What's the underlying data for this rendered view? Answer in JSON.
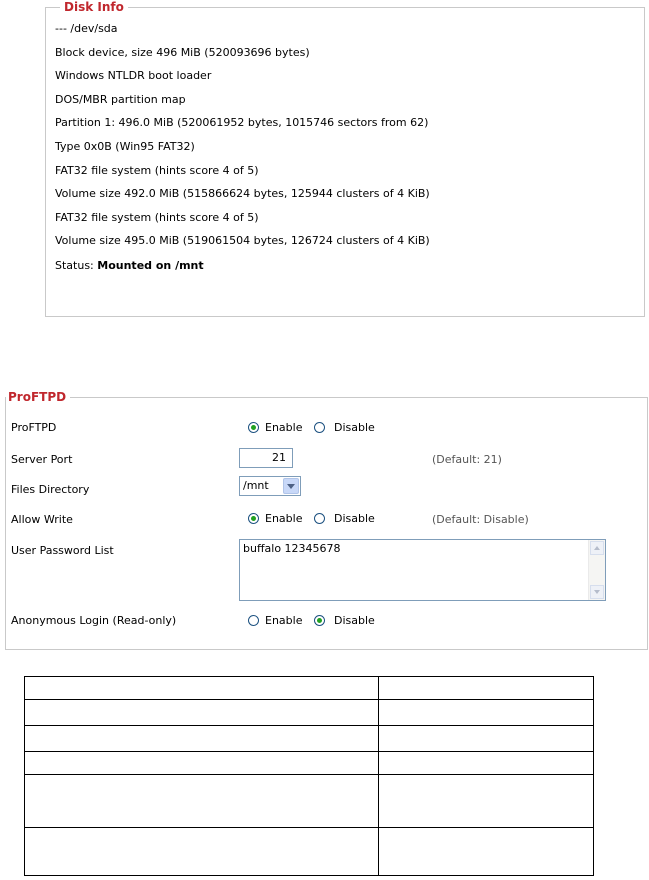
{
  "disk_info": {
    "legend": "Disk Info",
    "lines": [
      "--- /dev/sda",
      "Block device, size 496 MiB (520093696 bytes)",
      "Windows NTLDR boot loader",
      "DOS/MBR partition map",
      "Partition 1: 496.0 MiB (520061952 bytes, 1015746 sectors from 62)",
      "Type 0x0B (Win95 FAT32)",
      "FAT32 file system (hints score 4 of 5)",
      "Volume size 492.0 MiB (515866624 bytes, 125944 clusters of 4 KiB)",
      "FAT32 file system (hints score 4 of 5)",
      "Volume size 495.0 MiB (519061504 bytes, 126724 clusters of 4 KiB)"
    ],
    "status_label": "Status:",
    "status_value": "Mounted on /mnt"
  },
  "proftpd": {
    "legend": "ProFTPD",
    "enable_row": {
      "label": "ProFTPD",
      "enable_label": "Enable",
      "disable_label": "Disable",
      "selected": "Enable"
    },
    "server_port": {
      "label": "Server Port",
      "value": "21",
      "hint": "(Default: 21)"
    },
    "files_directory": {
      "label": "Files Directory",
      "selected": "/mnt"
    },
    "allow_write": {
      "label": "Allow Write",
      "enable_label": "Enable",
      "disable_label": "Disable",
      "selected": "Enable",
      "hint": "(Default: Disable)"
    },
    "user_password_list": {
      "label": "User Password List",
      "value": "buffalo 12345678"
    },
    "anonymous_login": {
      "label": "Anonymous Login (Read-only)",
      "enable_label": "Enable",
      "disable_label": "Disable",
      "selected": "Disable"
    }
  },
  "table": {
    "rows": 6,
    "columns": 2
  }
}
